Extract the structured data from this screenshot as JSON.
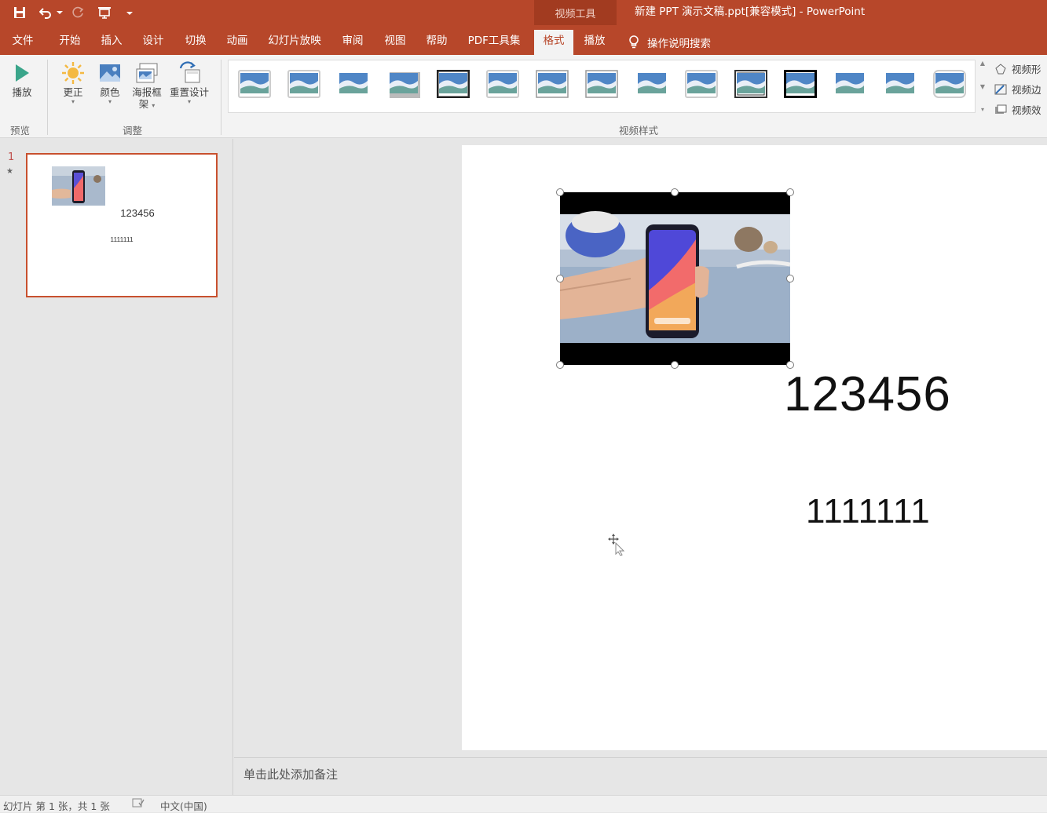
{
  "window": {
    "title": "新建 PPT 演示文稿.ppt[兼容模式]  -  PowerPoint",
    "context_tab_group": "视频工具"
  },
  "quick_access": {
    "icons": [
      "save-icon",
      "undo-icon",
      "dropdown-icon",
      "redo-icon",
      "present-from-beginning-icon",
      "customize-dropdown-icon"
    ]
  },
  "tabs": {
    "file": "文件",
    "home": "开始",
    "insert": "插入",
    "design": "设计",
    "transitions": "切换",
    "animations": "动画",
    "slideshow": "幻灯片放映",
    "review": "审阅",
    "view": "视图",
    "help": "帮助",
    "pdftools": "PDF工具集",
    "format": "格式",
    "playback": "播放",
    "active": "格式"
  },
  "tell_me": {
    "label": "操作说明搜索"
  },
  "ribbon": {
    "preview_group": {
      "label": "预览",
      "play": "播放"
    },
    "adjust_group": {
      "label": "调整",
      "corrections": "更正",
      "color": "颜色",
      "poster_frame_line1": "海报框",
      "poster_frame_line2": "架",
      "reset_design": "重置设计"
    },
    "video_styles_group": {
      "label": "视频样式",
      "style_count": 15
    },
    "side": {
      "video_shape": "视频形",
      "video_border": "视频边",
      "video_effects": "视频效"
    }
  },
  "thumbnail": {
    "number": "1",
    "star": "★",
    "title": "123456",
    "subtitle": "1111111"
  },
  "slide": {
    "title": "123456",
    "subtitle": "1111111"
  },
  "notes": {
    "placeholder": "单击此处添加备注"
  },
  "status": {
    "slide_info": "幻灯片 第 1 张，共 1 张",
    "language": "中文(中国)"
  },
  "colors": {
    "accent": "#b7472a",
    "accent_dark": "#a23b20",
    "ribbon_bg": "#f3f3f3",
    "workspace_bg": "#e6e6e6"
  }
}
